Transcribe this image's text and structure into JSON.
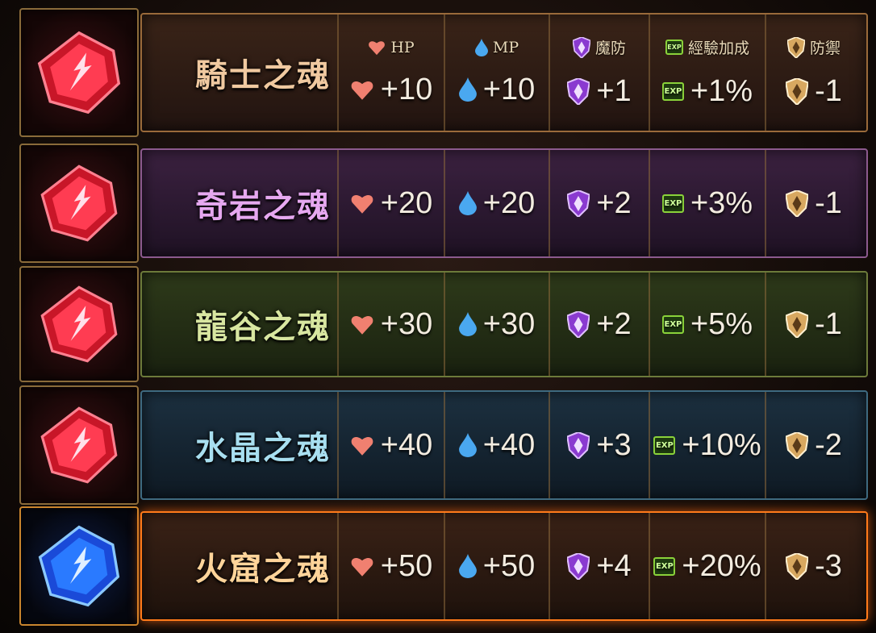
{
  "headers": {
    "hp": "HP",
    "mp": "MP",
    "mdef": "魔防",
    "exp": "經驗加成",
    "def": "防禦",
    "exp_badge": "EXP"
  },
  "rows": [
    {
      "name": "騎士之魂",
      "theme": "brown",
      "gem": "red",
      "hp": "+10",
      "mp": "+10",
      "mdef": "+1",
      "exp": "+1%",
      "def": "-1"
    },
    {
      "name": "奇岩之魂",
      "theme": "purple",
      "gem": "red",
      "hp": "+20",
      "mp": "+20",
      "mdef": "+2",
      "exp": "+3%",
      "def": "-1"
    },
    {
      "name": "龍谷之魂",
      "theme": "green",
      "gem": "red",
      "hp": "+30",
      "mp": "+30",
      "mdef": "+2",
      "exp": "+5%",
      "def": "-1"
    },
    {
      "name": "水晶之魂",
      "theme": "blue",
      "gem": "red",
      "hp": "+40",
      "mp": "+40",
      "mdef": "+3",
      "exp": "+10%",
      "def": "-2"
    },
    {
      "name": "火窟之魂",
      "theme": "fire",
      "gem": "blue",
      "hp": "+50",
      "mp": "+50",
      "mdef": "+4",
      "exp": "+20%",
      "def": "-3"
    }
  ],
  "colors": {
    "heart": "#f08070",
    "drop": "#4aa8f0",
    "purple_shield": "#8a3ad0",
    "gold_shield": "#d8a860",
    "exp_green": "#8ad23a",
    "red_gem": "#e8283c",
    "blue_gem": "#2a7aff"
  },
  "icons": {
    "hp": "heart-icon",
    "mp": "water-drop-icon",
    "mdef": "magic-shield-icon",
    "exp": "exp-badge-icon",
    "def": "defense-shield-icon",
    "gem": "soul-gem-icon"
  }
}
